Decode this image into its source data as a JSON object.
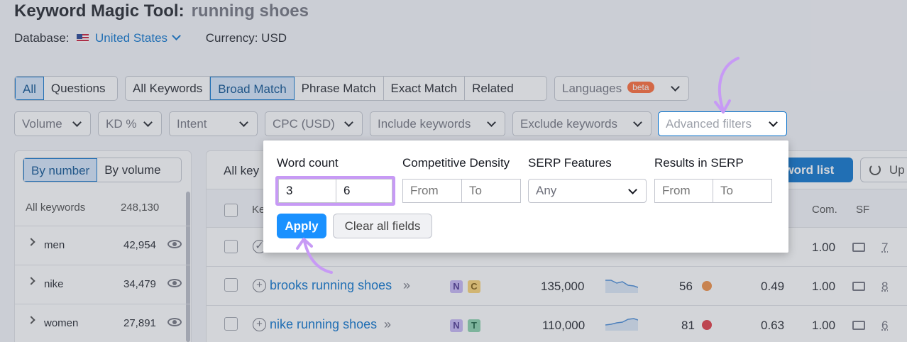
{
  "header": {
    "title": "Keyword Magic Tool:",
    "query": "running shoes",
    "database_label": "Database:",
    "database_value": "United States",
    "currency": "Currency: USD"
  },
  "tabs_type": [
    "All",
    "Questions"
  ],
  "tabs_match": [
    "All Keywords",
    "Broad Match",
    "Phrase Match",
    "Exact Match",
    "Related"
  ],
  "languages": {
    "label": "Languages",
    "badge": "beta"
  },
  "filters": [
    "Volume",
    "KD %",
    "Intent",
    "CPC (USD)",
    "Include keywords",
    "Exclude keywords"
  ],
  "advanced_filters": "Advanced filters",
  "popup": {
    "word_count": {
      "label": "Word count",
      "from": "3",
      "to": "6"
    },
    "competitive_density": {
      "label": "Competitive Density",
      "from": "From",
      "to": "To"
    },
    "serp_features": {
      "label": "SERP Features",
      "value": "Any"
    },
    "results_in_serp": {
      "label": "Results in SERP",
      "from": "From",
      "to": "To"
    },
    "apply": "Apply",
    "clear": "Clear all fields"
  },
  "left_panel": {
    "toggle": [
      "By number",
      "By volume"
    ],
    "all_keywords_label": "All keywords",
    "all_keywords_count": "248,130",
    "groups": [
      {
        "name": "men",
        "count": "42,954"
      },
      {
        "name": "nike",
        "count": "34,479"
      },
      {
        "name": "women",
        "count": "27,891"
      }
    ]
  },
  "table": {
    "all_key_label": "All key",
    "add_list_button": "yword list",
    "update_button": "Up",
    "col_keyword": "Ke",
    "col_com": "Com.",
    "col_sf": "SF",
    "rows": [
      {
        "keyword": "",
        "intents": [],
        "volume": "",
        "kd": "",
        "cpc": "",
        "com": "1.00",
        "sf": "7"
      },
      {
        "keyword": "brooks running shoes",
        "intents": [
          "N",
          "C"
        ],
        "volume": "135,000",
        "kd": "56",
        "cpc": "0.49",
        "com": "1.00",
        "sf": "8",
        "kd_color": "#f08a3c"
      },
      {
        "keyword": "nike running shoes",
        "intents": [
          "N",
          "T"
        ],
        "volume": "110,000",
        "kd": "81",
        "cpc": "0.63",
        "com": "1.00",
        "sf": "6",
        "kd_color": "#e0323c"
      }
    ]
  },
  "colors": {
    "accent": "#006dca",
    "apply": "#1a91ff",
    "highlight": "#c79af5",
    "intent_n": "#c4b3f5",
    "intent_c": "#fcd26e",
    "intent_t": "#84d0a8"
  }
}
